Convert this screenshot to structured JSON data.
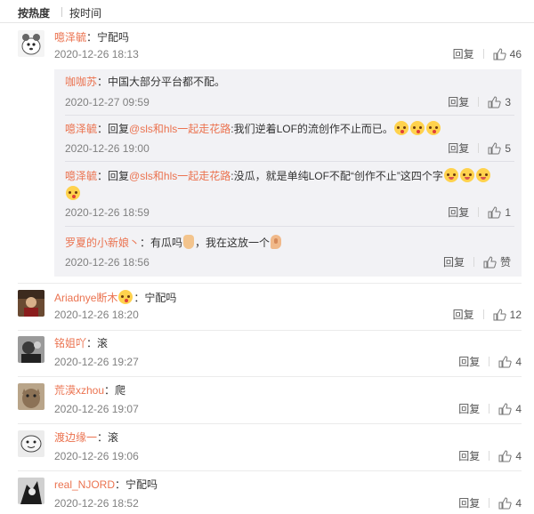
{
  "sort": {
    "hot": "按热度",
    "time": "按时间"
  },
  "reply_label": "回复",
  "comments": [
    {
      "user": "噫泽毓",
      "sep": "：",
      "text": "宁配吗",
      "time": "2020-12-26 18:13",
      "likes": "46"
    },
    {
      "user": "Ariadnye断木",
      "sep": "：",
      "text": "宁配吗",
      "time": "2020-12-26 18:20",
      "likes": "12"
    },
    {
      "user": "铭姐吖",
      "sep": "：",
      "text": "滚",
      "time": "2020-12-26 19:27",
      "likes": "4"
    },
    {
      "user": "荒漠xzhou",
      "sep": "：",
      "text": "爬",
      "time": "2020-12-26 19:07",
      "likes": "4"
    },
    {
      "user": "渡边缘一",
      "sep": "：",
      "text": "滚",
      "time": "2020-12-26 19:06",
      "likes": "4"
    },
    {
      "user": "real_NJORD",
      "sep": "：",
      "text": "宁配吗",
      "time": "2020-12-26 18:52",
      "likes": "4"
    }
  ],
  "replies": [
    {
      "user": "咖咖苏",
      "sep": "：",
      "text": "中国大部分平台都不配。",
      "time": "2020-12-27 09:59",
      "likes": "3"
    },
    {
      "user": "噫泽毓",
      "sep": "：",
      "prefix": "回复",
      "at": "@sls和hls一起走花路",
      "text": ":我们逆着LOF的流创作不止而已。",
      "time": "2020-12-26 19:00",
      "likes": "5"
    },
    {
      "user": "噫泽毓",
      "sep": "：",
      "prefix": "回复",
      "at": "@sls和hls一起走花路",
      "text": ":没瓜，就是单纯LOF不配“创作不止”这四个字",
      "time": "2020-12-26 18:59",
      "likes": "1"
    },
    {
      "user": "罗夏的小新娘丶",
      "sep": "：",
      "text": "有瓜吗",
      "text2": "，我在这放一个",
      "time": "2020-12-26 18:56",
      "likes": "赞"
    }
  ],
  "icons": {
    "like": "thumbs-up-icon",
    "emoji": "face-emoji-icon"
  },
  "colors": {
    "username": "#eb7350",
    "meta": "#808080",
    "reply_bg": "#f2f2f5"
  }
}
